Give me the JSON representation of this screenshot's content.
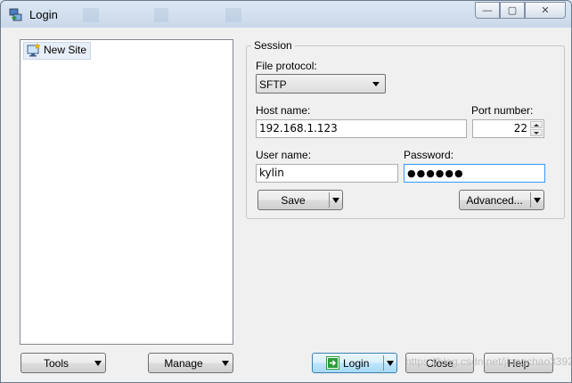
{
  "window": {
    "title": "Login",
    "controls": {
      "minimize": "—",
      "maximize": "▢",
      "close": "✕"
    }
  },
  "site_tree": {
    "items": [
      {
        "label": "New Site",
        "icon": "monitor-new-site-icon"
      }
    ]
  },
  "session": {
    "group_label": "Session",
    "file_protocol": {
      "label": "File protocol:",
      "value": "SFTP"
    },
    "host_name": {
      "label": "Host name:",
      "value": "192.168.1.123"
    },
    "port_number": {
      "label": "Port number:",
      "value": "22"
    },
    "user_name": {
      "label": "User name:",
      "value": "kylin"
    },
    "password": {
      "label": "Password:",
      "value": "●●●●●●"
    },
    "save_label": "Save",
    "advanced_label": "Advanced..."
  },
  "bottom": {
    "tools_label": "Tools",
    "manage_label": "Manage",
    "login_label": "Login",
    "close_label": "Close",
    "help_label": "Help"
  },
  "watermark": "https://blog.csdn.net/jiangchao3392",
  "colors": {
    "accent": "#3c7fb1",
    "titlebar": "#c9d8ea",
    "login_icon": "#2e9b3c"
  }
}
